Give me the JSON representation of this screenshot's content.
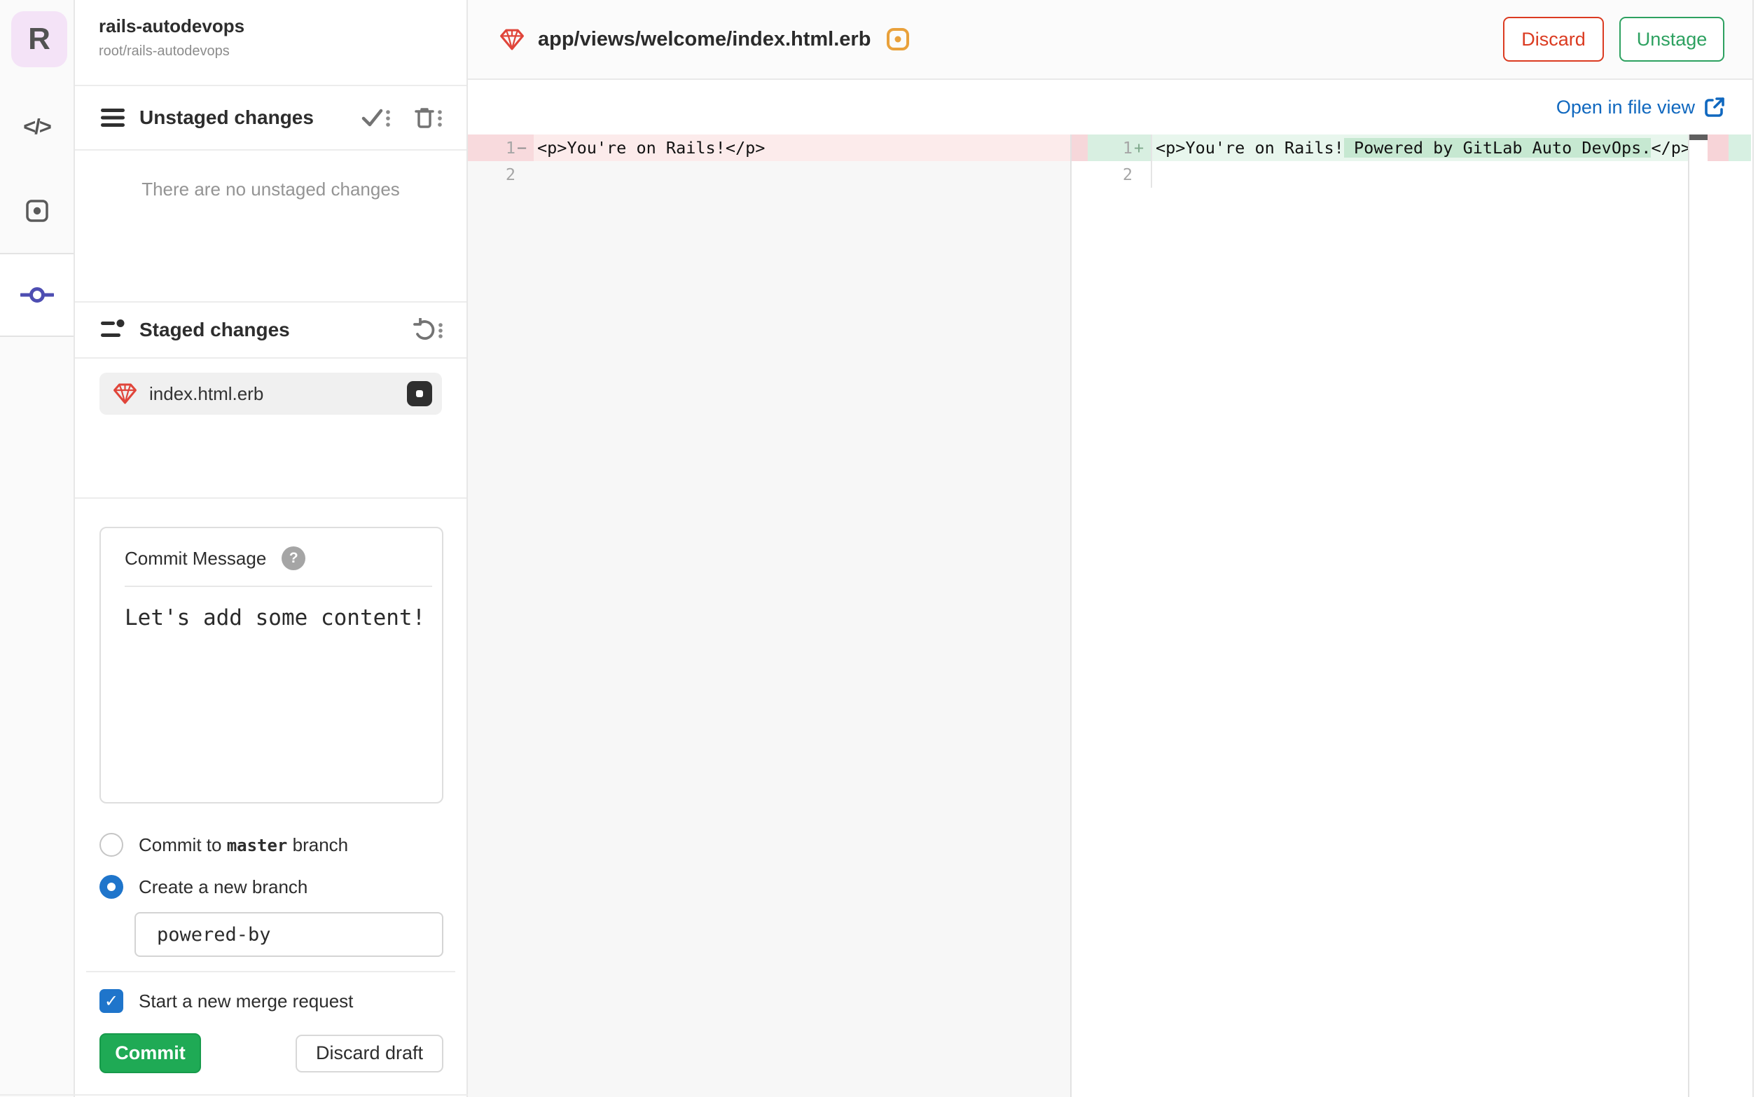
{
  "project": {
    "avatar_letter": "R",
    "name": "rails-autodevops",
    "path": "root/rails-autodevops"
  },
  "icons": {
    "code_glyph": "</>",
    "help_glyph": "?",
    "check_glyph": "✓"
  },
  "commit_panel": {
    "unstaged": {
      "title": "Unstaged changes",
      "empty_message": "There are no unstaged changes"
    },
    "staged": {
      "title": "Staged changes",
      "files": [
        {
          "name": "index.html.erb",
          "icon": "ruby-file-icon",
          "status": "modified"
        }
      ]
    },
    "commit_message": {
      "label": "Commit Message",
      "value": "Let's add some content!"
    },
    "branch_options": {
      "commit_to_branch": {
        "prefix": "Commit to ",
        "branch": "master",
        "suffix": " branch",
        "selected": false
      },
      "new_branch": {
        "label": "Create a new branch",
        "selected": true
      },
      "branch_name_value": "powered-by"
    },
    "merge_request": {
      "label": "Start a new merge request",
      "checked": true
    },
    "actions": {
      "commit": "Commit",
      "discard_draft": "Discard draft"
    }
  },
  "diff_header": {
    "file_path": "app/views/welcome/index.html.erb",
    "discard": "Discard",
    "unstage": "Unstage"
  },
  "link_bar": {
    "open_in_file_view": "Open in file view"
  },
  "diff": {
    "left": {
      "lines": [
        {
          "number": "1",
          "sign": "−",
          "text": "<p>You're on Rails!</p>",
          "type": "removed"
        },
        {
          "number": "2",
          "sign": "",
          "text": "",
          "type": "context"
        }
      ]
    },
    "right": {
      "lines": [
        {
          "number": "1",
          "sign": "+",
          "type": "added",
          "segments": [
            {
              "text": "<p>You're on Rails!",
              "highlight": false
            },
            {
              "text": " Powered by GitLab Auto DevOps.",
              "highlight": true
            },
            {
              "text": "</p>",
              "highlight": false
            }
          ]
        },
        {
          "number": "2",
          "sign": "",
          "type": "context",
          "segments": []
        }
      ]
    }
  },
  "colors": {
    "link_blue": "#1068bf",
    "accent_blue": "#1f75cb",
    "success_green": "#1faa55",
    "danger_red": "#db3b21",
    "removed_row": "#fcebeb",
    "added_row": "#e8f6ed",
    "added_inline": "#c6e8d1",
    "active_rail_indigo": "#4e4eb2",
    "ruby_red": "#e0453a",
    "modified_amber": "#e9a13b"
  }
}
